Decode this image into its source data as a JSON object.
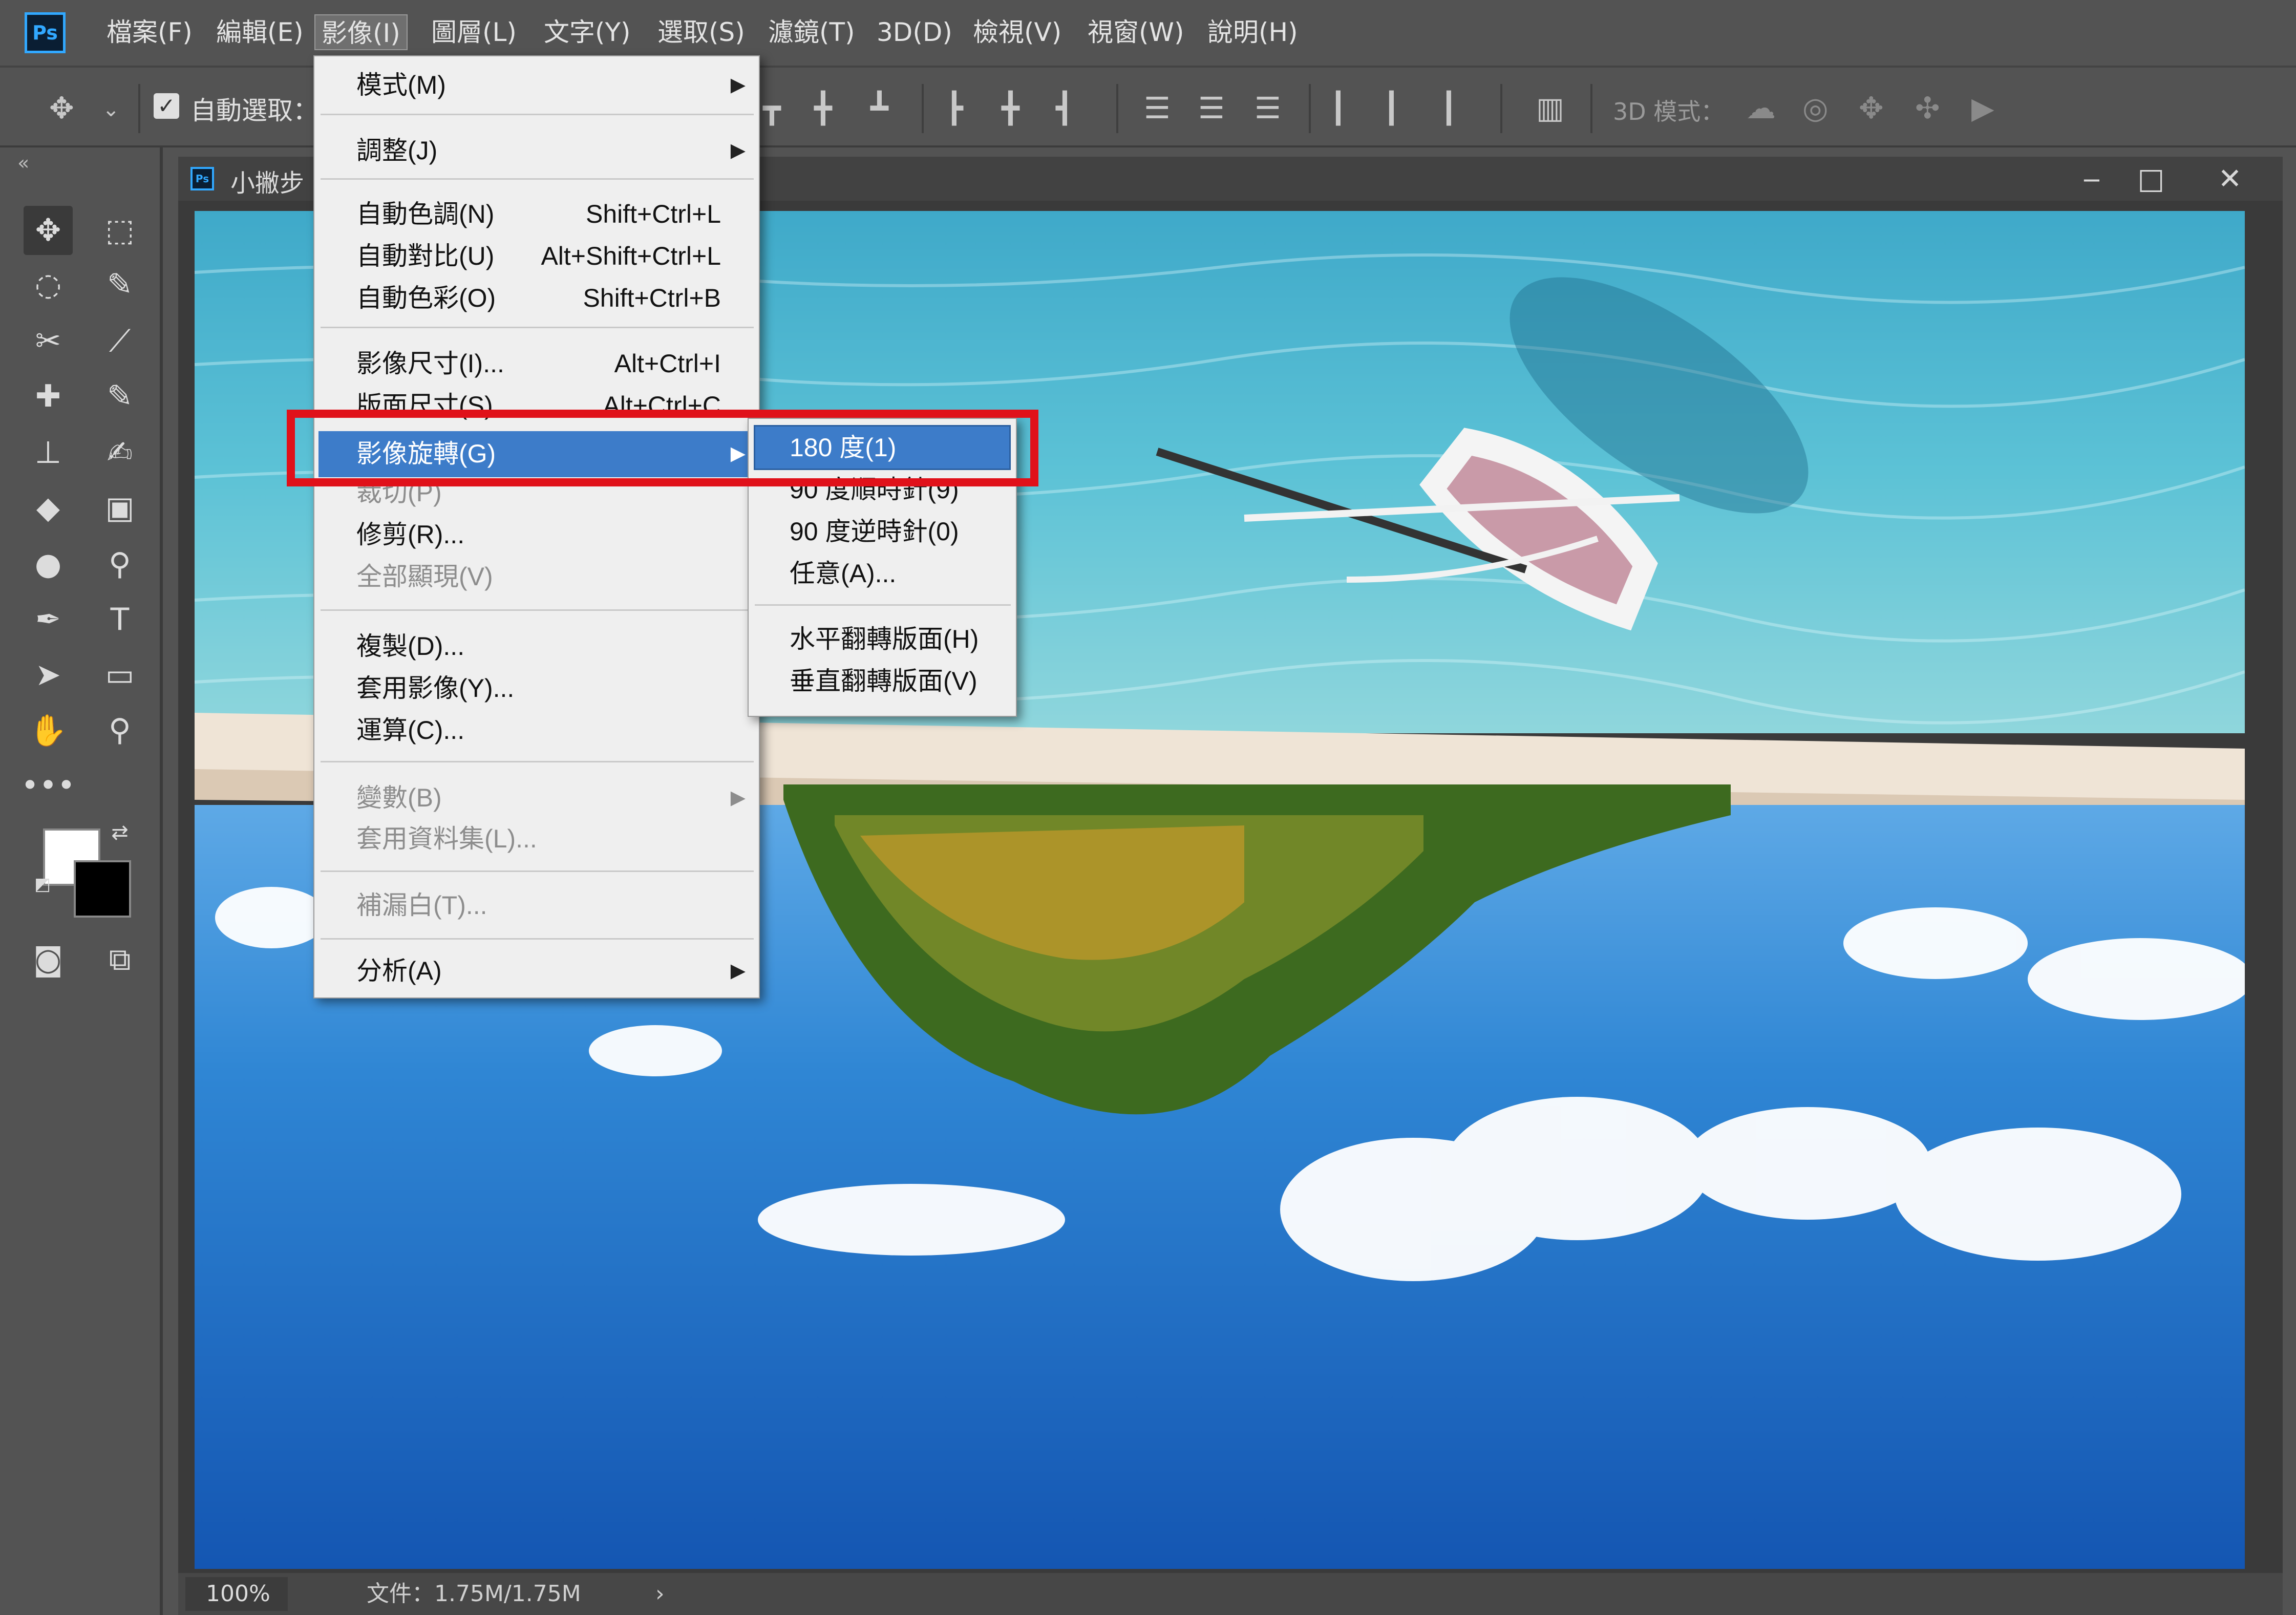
{
  "app": {
    "logo": "Ps"
  },
  "menubar": {
    "items": [
      "檔案(F)",
      "編輯(E)",
      "影像(I)",
      "圖層(L)",
      "文字(Y)",
      "選取(S)",
      "濾鏡(T)",
      "3D(D)",
      "檢視(V)",
      "視窗(W)",
      "說明(H)"
    ],
    "active": "影像(I)"
  },
  "options_bar": {
    "move_icon": "move-icon",
    "auto_select_checked": true,
    "auto_select_label": "自動選取：",
    "mode_3d_label": "3D 模式："
  },
  "document": {
    "tab_title": "小撇步",
    "zoom": "100%",
    "info": "文件：1.75M/1.75M",
    "image": "upside-down beach photo: sky, palm trees, sand, turquoise water, boat"
  },
  "image_menu": {
    "items": [
      {
        "label": "模式(M)",
        "shortcut": "",
        "submenu": true,
        "disabled": false
      },
      {
        "label": "調整(J)",
        "shortcut": "",
        "submenu": true,
        "disabled": false
      },
      {
        "label": "自動色調(N)",
        "shortcut": "Shift+Ctrl+L",
        "submenu": false,
        "disabled": false
      },
      {
        "label": "自動對比(U)",
        "shortcut": "Alt+Shift+Ctrl+L",
        "submenu": false,
        "disabled": false
      },
      {
        "label": "自動色彩(O)",
        "shortcut": "Shift+Ctrl+B",
        "submenu": false,
        "disabled": false
      },
      {
        "label": "影像尺寸(I)...",
        "shortcut": "Alt+Ctrl+I",
        "submenu": false,
        "disabled": false
      },
      {
        "label": "版面尺寸(S)...",
        "shortcut": "Alt+Ctrl+C",
        "submenu": false,
        "disabled": false
      },
      {
        "label": "影像旋轉(G)",
        "shortcut": "",
        "submenu": true,
        "disabled": false,
        "highlighted": true
      },
      {
        "label": "裁切(P)",
        "shortcut": "",
        "submenu": false,
        "disabled": true
      },
      {
        "label": "修剪(R)...",
        "shortcut": "",
        "submenu": false,
        "disabled": false
      },
      {
        "label": "全部顯現(V)",
        "shortcut": "",
        "submenu": false,
        "disabled": true
      },
      {
        "label": "複製(D)...",
        "shortcut": "",
        "submenu": false,
        "disabled": false
      },
      {
        "label": "套用影像(Y)...",
        "shortcut": "",
        "submenu": false,
        "disabled": false
      },
      {
        "label": "運算(C)...",
        "shortcut": "",
        "submenu": false,
        "disabled": false
      },
      {
        "label": "變數(B)",
        "shortcut": "",
        "submenu": true,
        "disabled": true
      },
      {
        "label": "套用資料集(L)...",
        "shortcut": "",
        "submenu": false,
        "disabled": true
      },
      {
        "label": "補漏白(T)...",
        "shortcut": "",
        "submenu": false,
        "disabled": true
      },
      {
        "label": "分析(A)",
        "shortcut": "",
        "submenu": true,
        "disabled": false
      }
    ]
  },
  "rotate_submenu": {
    "items": [
      "180 度(1)",
      "90 度順時針(9)",
      "90 度逆時針(0)",
      "任意(A)...",
      "水平翻轉版面(H)",
      "垂直翻轉版面(V)"
    ],
    "highlighted": "180 度(1)"
  },
  "colors": {
    "highlight": "#3d7cc9",
    "annotation": "#e0111a",
    "foreground": "#ffffff",
    "background": "#000000"
  }
}
